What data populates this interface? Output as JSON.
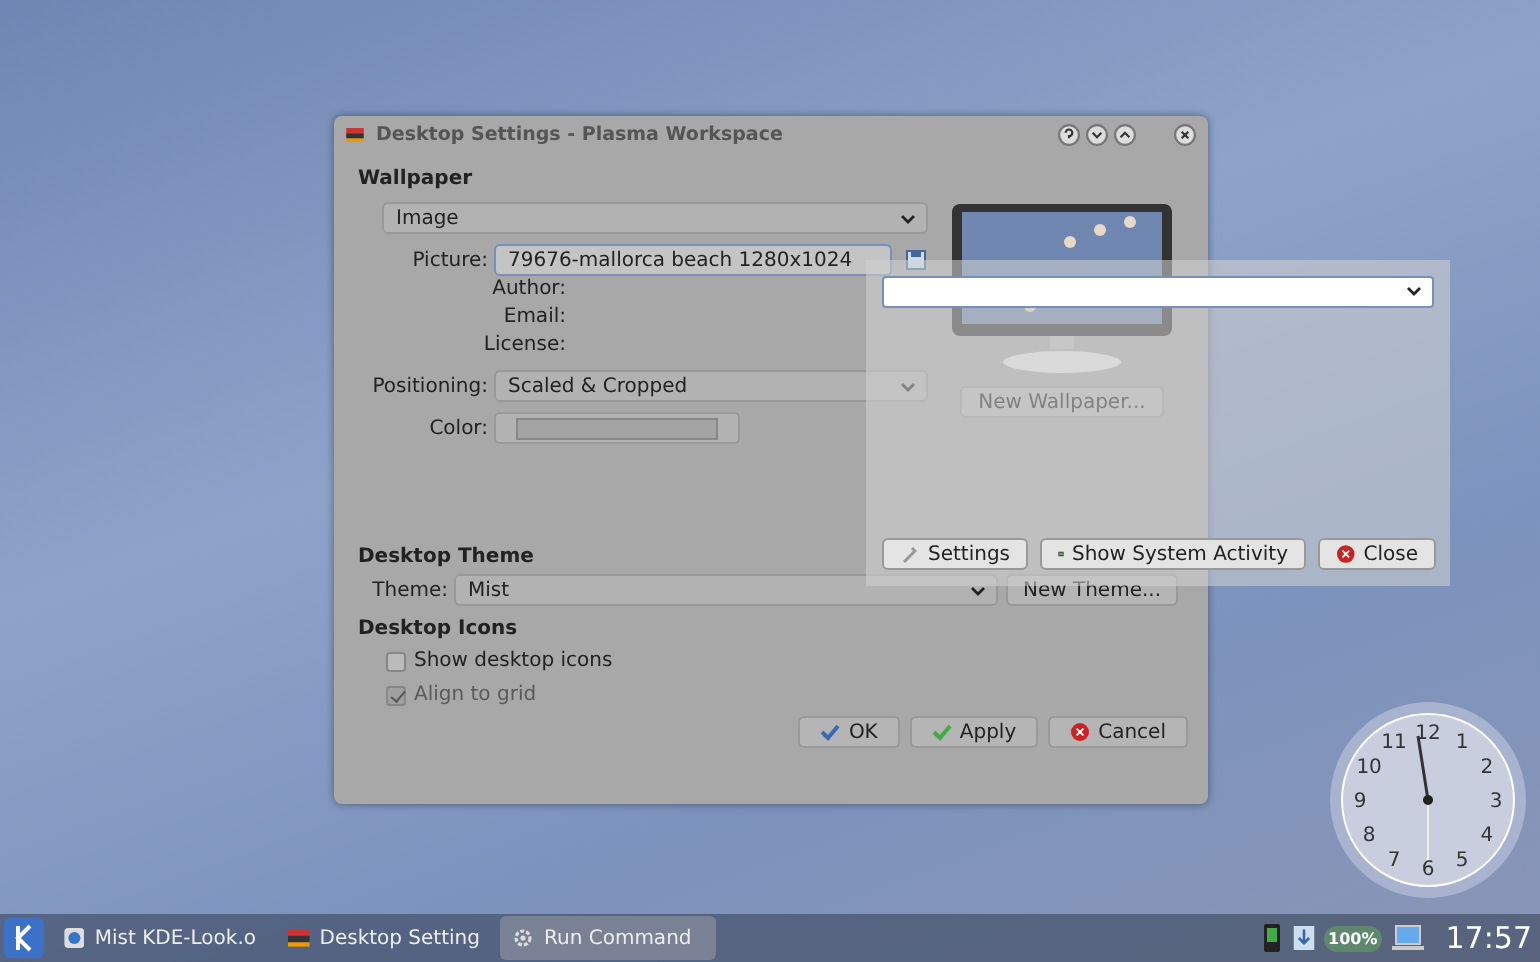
{
  "dialog": {
    "title": "Desktop Settings - Plasma Workspace",
    "wallpaper": {
      "heading": "Wallpaper",
      "type_value": "Image",
      "picture": {
        "label": "Picture:",
        "value": "79676-mallorca beach 1280x1024"
      },
      "info_labels": [
        "Author:",
        "Email:",
        "License:"
      ],
      "positioning": {
        "label": "Positioning:",
        "value": "Scaled & Cropped"
      },
      "color": {
        "label": "Color:"
      },
      "new_button": "New Wallpaper..."
    },
    "theme": {
      "heading": "Desktop Theme",
      "label": "Theme:",
      "value": "Mist",
      "new_button": "New Theme..."
    },
    "icons": {
      "heading": "Desktop Icons",
      "options": [
        {
          "label": "Show desktop icons",
          "checked": false,
          "disabled": false
        },
        {
          "label": "Align to grid",
          "checked": true,
          "disabled": true
        }
      ]
    },
    "buttons": [
      {
        "label": "OK",
        "kind": "ok"
      },
      {
        "label": "Apply",
        "kind": "apply"
      },
      {
        "label": "Cancel",
        "kind": "cancel"
      }
    ]
  },
  "run_command": {
    "buttons": [
      {
        "label": "Settings",
        "kind": "settings"
      },
      {
        "label": "Show System Activity",
        "kind": "activity"
      },
      {
        "label": "Close",
        "kind": "close"
      }
    ]
  },
  "clock": {
    "numerals": [
      "12",
      "11",
      "1",
      "10",
      "2",
      "9",
      "3",
      "8",
      "4",
      "7",
      "5",
      "6"
    ]
  },
  "taskbar": {
    "tasks": [
      {
        "label": "Mist KDE-Look.o",
        "kind": "browser",
        "selected": false
      },
      {
        "label": "Desktop Setting",
        "kind": "settings",
        "selected": false
      },
      {
        "label": "Run Command",
        "kind": "run",
        "selected": true
      }
    ],
    "battery": "100%",
    "time": "17:57"
  }
}
